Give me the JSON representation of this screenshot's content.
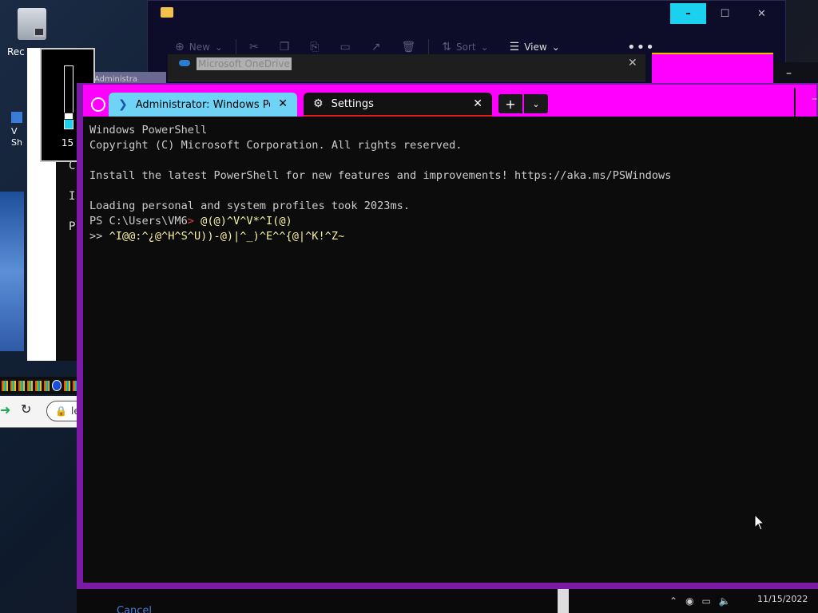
{
  "desktop": {
    "recycle_bin_label": "Rec",
    "shortcut_label_line1": "V",
    "shortcut_label_line2": "Sh"
  },
  "explorer": {
    "toolbar": {
      "new_label": "New",
      "sort_label": "Sort",
      "view_label": "View"
    },
    "min_glyph": "–",
    "max_glyph": "☐",
    "close_glyph": "✕",
    "more_glyph": "•••"
  },
  "onedrive": {
    "title": "Microsoft OneDrive",
    "close_glyph": "✕"
  },
  "left_window": {
    "tab_label": "Administra",
    "letters": [
      "C",
      "I",
      "P"
    ]
  },
  "volume": {
    "level": 15,
    "level_label": "15"
  },
  "browser": {
    "url_text": "le"
  },
  "terminal": {
    "tabs": [
      {
        "label": "Administrator: Windows PowerShell",
        "active": true
      },
      {
        "label": "Settings",
        "active": false
      }
    ],
    "new_tab_glyph": "+",
    "dropdown_glyph": "⌄",
    "min_glyph": "–",
    "lines": [
      "Windows PowerShell",
      "Copyright (C) Microsoft Corporation. All rights reserved.",
      "",
      "Install the latest PowerShell for new features and improvements! https://aka.ms/PSWindows",
      "",
      "Loading personal and system profiles took 2023ms."
    ],
    "prompt_path": "PS C:\\Users\\VM6",
    "prompt_arrow": ">",
    "command_part1": " @(@)^V^V*^I(@)",
    "continuation_prefix": ">> ",
    "command_part2": "^I@@:^¿@^H^S^U))-@)|^_)^E^^{@|^K!^Z~"
  },
  "taskbar": {
    "cancel_label": "Cancel",
    "date": "11/15/2022"
  },
  "colors": {
    "terminal_frame": "#7a1aa5",
    "tab_bar": "#ff00ff",
    "active_tab": "#6fd3f5",
    "accent_cyan": "#1ad2f0",
    "prompt_red": "#e0442a",
    "command_yellow": "#f9f1a5"
  }
}
